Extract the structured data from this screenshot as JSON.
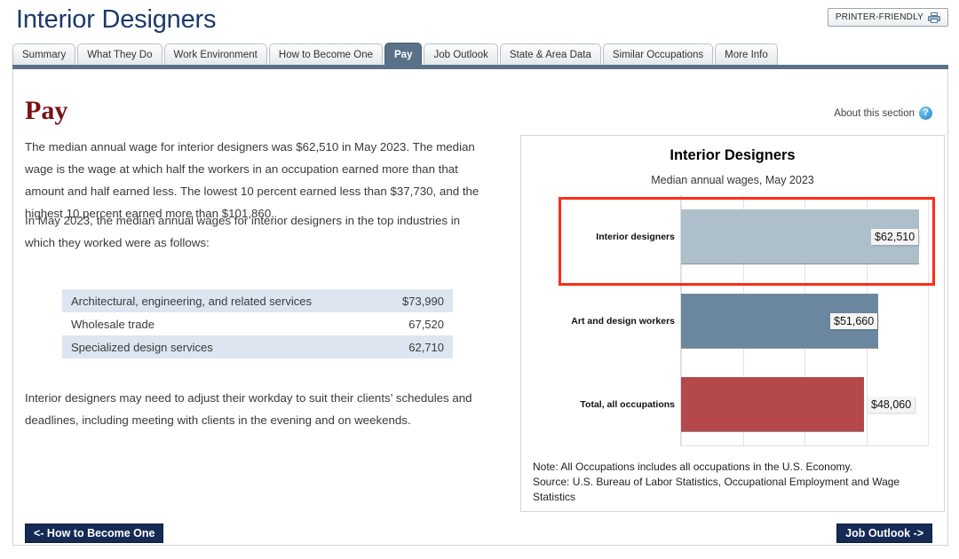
{
  "header": {
    "title": "Interior Designers",
    "printer_button": "PRINTER-FRIENDLY",
    "printer_icon": "printer-icon"
  },
  "tabs": [
    {
      "label": "Summary",
      "active": false
    },
    {
      "label": "What They Do",
      "active": false
    },
    {
      "label": "Work Environment",
      "active": false
    },
    {
      "label": "How to Become One",
      "active": false
    },
    {
      "label": "Pay",
      "active": true
    },
    {
      "label": "Job Outlook",
      "active": false
    },
    {
      "label": "State & Area Data",
      "active": false
    },
    {
      "label": "Similar Occupations",
      "active": false
    },
    {
      "label": "More Info",
      "active": false
    }
  ],
  "main": {
    "section_heading": "Pay",
    "about_section_label": "About this section",
    "about_section_icon": "question-mark-icon",
    "paragraph_1": "The median annual wage for interior designers was $62,510 in May 2023. The median wage is the wage at which half the workers in an occupation earned more than that amount and half earned less. The lowest 10 percent earned less than $37,730, and the highest 10 percent earned more than $101,860.",
    "paragraph_2": "In May 2023, the median annual wages for interior designers in the top industries in which they worked were as follows:",
    "paragraph_3": "Interior designers may need to adjust their workday to suit their clients’ schedules and deadlines, including meeting with clients in the evening and on weekends.",
    "industry_table": [
      {
        "industry": "Architectural, engineering, and related services",
        "wage": "$73,990"
      },
      {
        "industry": "Wholesale trade",
        "wage": "67,520"
      },
      {
        "industry": "Specialized design services",
        "wage": "62,710"
      }
    ]
  },
  "footer": {
    "prev_button": "<- How to Become One",
    "next_button": "Job Outlook ->"
  },
  "chart_data": {
    "type": "bar",
    "orientation": "horizontal",
    "title": "Interior Designers",
    "subtitle": "Median annual wages, May 2023",
    "xlabel": "",
    "ylabel": "",
    "xlim": [
      0,
      65000
    ],
    "grid": true,
    "legend": null,
    "categories": [
      "Interior designers",
      "Art and design workers",
      "Total, all occupations"
    ],
    "values": [
      62510,
      51660,
      48060
    ],
    "value_labels": [
      "$62,510",
      "$51,660",
      "$48,060"
    ],
    "colors": [
      "#adbfcb",
      "#6b87a0",
      "#b5484a"
    ],
    "highlighted_category": "Interior designers",
    "highlight_color": "#fb2d17",
    "note": "Note: All Occupations includes all occupations in the U.S. Economy.",
    "source": "Source: U.S. Bureau of Labor Statistics, Occupational Employment and Wage Statistics"
  }
}
